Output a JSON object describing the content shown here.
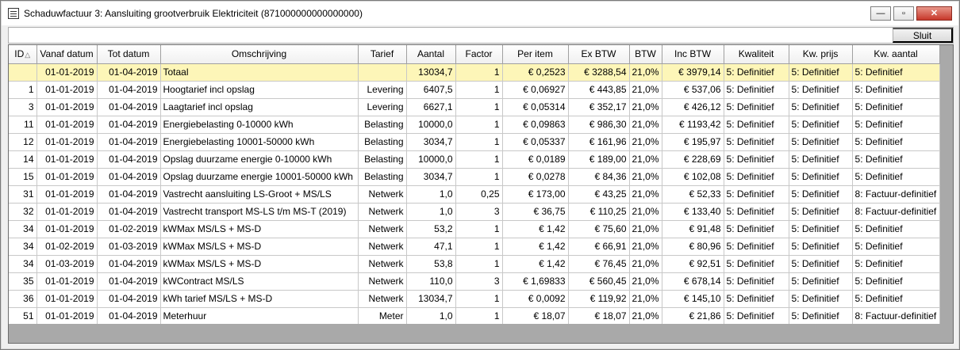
{
  "window": {
    "title": "Schaduwfactuur 3: Aansluiting grootverbruik Elektriciteit (871000000000000000)",
    "controls": {
      "minimize": "—",
      "maximize": "▫",
      "close": "✕"
    }
  },
  "toolbar": {
    "close_label": "Sluit"
  },
  "table": {
    "sort_indicator": "△",
    "headers": [
      "ID",
      "Vanaf datum",
      "Tot datum",
      "Omschrijving",
      "Tarief",
      "Aantal",
      "Factor",
      "Per item",
      "Ex BTW",
      "BTW",
      "Inc BTW",
      "Kwaliteit",
      "Kw. prijs",
      "Kw. aantal"
    ],
    "total_row": [
      "",
      "01-01-2019",
      "01-04-2019",
      "Totaal",
      "",
      "13034,7",
      "1",
      "€ 0,2523",
      "€ 3288,54",
      "21,0%",
      "€ 3979,14",
      "5: Definitief",
      "5: Definitief",
      "5: Definitief"
    ],
    "rows": [
      [
        "1",
        "01-01-2019",
        "01-04-2019",
        "Hoogtarief incl opslag",
        "Levering",
        "6407,5",
        "1",
        "€ 0,06927",
        "€ 443,85",
        "21,0%",
        "€ 537,06",
        "5: Definitief",
        "5: Definitief",
        "5: Definitief"
      ],
      [
        "3",
        "01-01-2019",
        "01-04-2019",
        "Laagtarief incl opslag",
        "Levering",
        "6627,1",
        "1",
        "€ 0,05314",
        "€ 352,17",
        "21,0%",
        "€ 426,12",
        "5: Definitief",
        "5: Definitief",
        "5: Definitief"
      ],
      [
        "11",
        "01-01-2019",
        "01-04-2019",
        "Energiebelasting 0-10000 kWh",
        "Belasting",
        "10000,0",
        "1",
        "€ 0,09863",
        "€ 986,30",
        "21,0%",
        "€ 1193,42",
        "5: Definitief",
        "5: Definitief",
        "5: Definitief"
      ],
      [
        "12",
        "01-01-2019",
        "01-04-2019",
        "Energiebelasting 10001-50000 kWh",
        "Belasting",
        "3034,7",
        "1",
        "€ 0,05337",
        "€ 161,96",
        "21,0%",
        "€ 195,97",
        "5: Definitief",
        "5: Definitief",
        "5: Definitief"
      ],
      [
        "14",
        "01-01-2019",
        "01-04-2019",
        "Opslag duurzame energie 0-10000 kWh",
        "Belasting",
        "10000,0",
        "1",
        "€ 0,0189",
        "€ 189,00",
        "21,0%",
        "€ 228,69",
        "5: Definitief",
        "5: Definitief",
        "5: Definitief"
      ],
      [
        "15",
        "01-01-2019",
        "01-04-2019",
        "Opslag duurzame energie 10001-50000 kWh",
        "Belasting",
        "3034,7",
        "1",
        "€ 0,0278",
        "€ 84,36",
        "21,0%",
        "€ 102,08",
        "5: Definitief",
        "5: Definitief",
        "5: Definitief"
      ],
      [
        "31",
        "01-01-2019",
        "01-04-2019",
        "Vastrecht aansluiting LS-Groot + MS/LS",
        "Netwerk",
        "1,0",
        "0,25",
        "€ 173,00",
        "€ 43,25",
        "21,0%",
        "€ 52,33",
        "5: Definitief",
        "5: Definitief",
        "8: Factuur-definitief"
      ],
      [
        "32",
        "01-01-2019",
        "01-04-2019",
        "Vastrecht transport MS-LS t/m MS-T (2019)",
        "Netwerk",
        "1,0",
        "3",
        "€ 36,75",
        "€ 110,25",
        "21,0%",
        "€ 133,40",
        "5: Definitief",
        "5: Definitief",
        "8: Factuur-definitief"
      ],
      [
        "34",
        "01-01-2019",
        "01-02-2019",
        "kWMax MS/LS + MS-D",
        "Netwerk",
        "53,2",
        "1",
        "€ 1,42",
        "€ 75,60",
        "21,0%",
        "€ 91,48",
        "5: Definitief",
        "5: Definitief",
        "5: Definitief"
      ],
      [
        "34",
        "01-02-2019",
        "01-03-2019",
        "kWMax MS/LS + MS-D",
        "Netwerk",
        "47,1",
        "1",
        "€ 1,42",
        "€ 66,91",
        "21,0%",
        "€ 80,96",
        "5: Definitief",
        "5: Definitief",
        "5: Definitief"
      ],
      [
        "34",
        "01-03-2019",
        "01-04-2019",
        "kWMax MS/LS + MS-D",
        "Netwerk",
        "53,8",
        "1",
        "€ 1,42",
        "€ 76,45",
        "21,0%",
        "€ 92,51",
        "5: Definitief",
        "5: Definitief",
        "5: Definitief"
      ],
      [
        "35",
        "01-01-2019",
        "01-04-2019",
        "kWContract MS/LS",
        "Netwerk",
        "110,0",
        "3",
        "€ 1,69833",
        "€ 560,45",
        "21,0%",
        "€ 678,14",
        "5: Definitief",
        "5: Definitief",
        "5: Definitief"
      ],
      [
        "36",
        "01-01-2019",
        "01-04-2019",
        "kWh tarief MS/LS + MS-D",
        "Netwerk",
        "13034,7",
        "1",
        "€ 0,0092",
        "€ 119,92",
        "21,0%",
        "€ 145,10",
        "5: Definitief",
        "5: Definitief",
        "5: Definitief"
      ],
      [
        "51",
        "01-01-2019",
        "01-04-2019",
        "Meterhuur",
        "Meter",
        "1,0",
        "1",
        "€ 18,07",
        "€ 18,07",
        "21,0%",
        "€ 21,86",
        "5: Definitief",
        "5: Definitief",
        "8: Factuur-definitief"
      ]
    ]
  }
}
